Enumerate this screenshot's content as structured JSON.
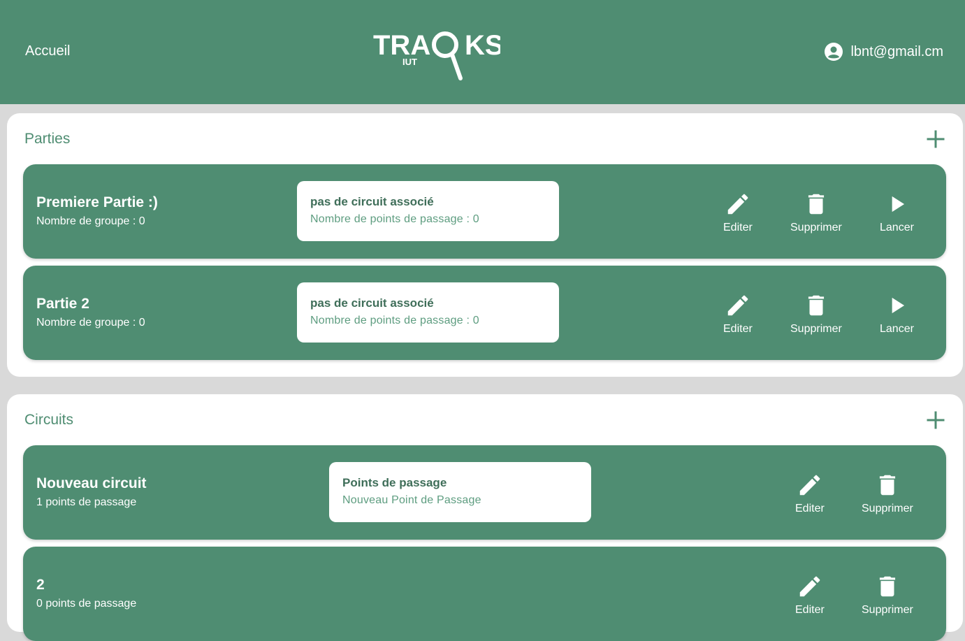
{
  "header": {
    "home_label": "Accueil",
    "logo_text": "TRACKS",
    "logo_subtext": "IUT",
    "user_email": "lbnt@gmail.cm"
  },
  "parties": {
    "title": "Parties",
    "items": [
      {
        "name": "Premiere Partie :)",
        "groups": "Nombre de groupe : 0",
        "circuit_title": "pas de circuit associé",
        "circuit_points": "Nombre de points de passage : 0",
        "edit": "Editer",
        "delete": "Supprimer",
        "launch": "Lancer"
      },
      {
        "name": "Partie 2",
        "groups": "Nombre de groupe : 0",
        "circuit_title": "pas de circuit associé",
        "circuit_points": "Nombre de points de passage : 0",
        "edit": "Editer",
        "delete": "Supprimer",
        "launch": "Lancer"
      }
    ]
  },
  "circuits": {
    "title": "Circuits",
    "items": [
      {
        "name": "Nouveau circuit",
        "points": "1 points de passage",
        "box_title": "Points de passage",
        "box_value": "Nouveau Point de Passage",
        "edit": "Editer",
        "delete": "Supprimer"
      },
      {
        "name": "2",
        "points": "0 points de passage",
        "edit": "Editer",
        "delete": "Supprimer"
      }
    ]
  },
  "colors": {
    "primary": "#4f8d72",
    "background": "#d9d9d9",
    "panel": "#ffffff"
  }
}
